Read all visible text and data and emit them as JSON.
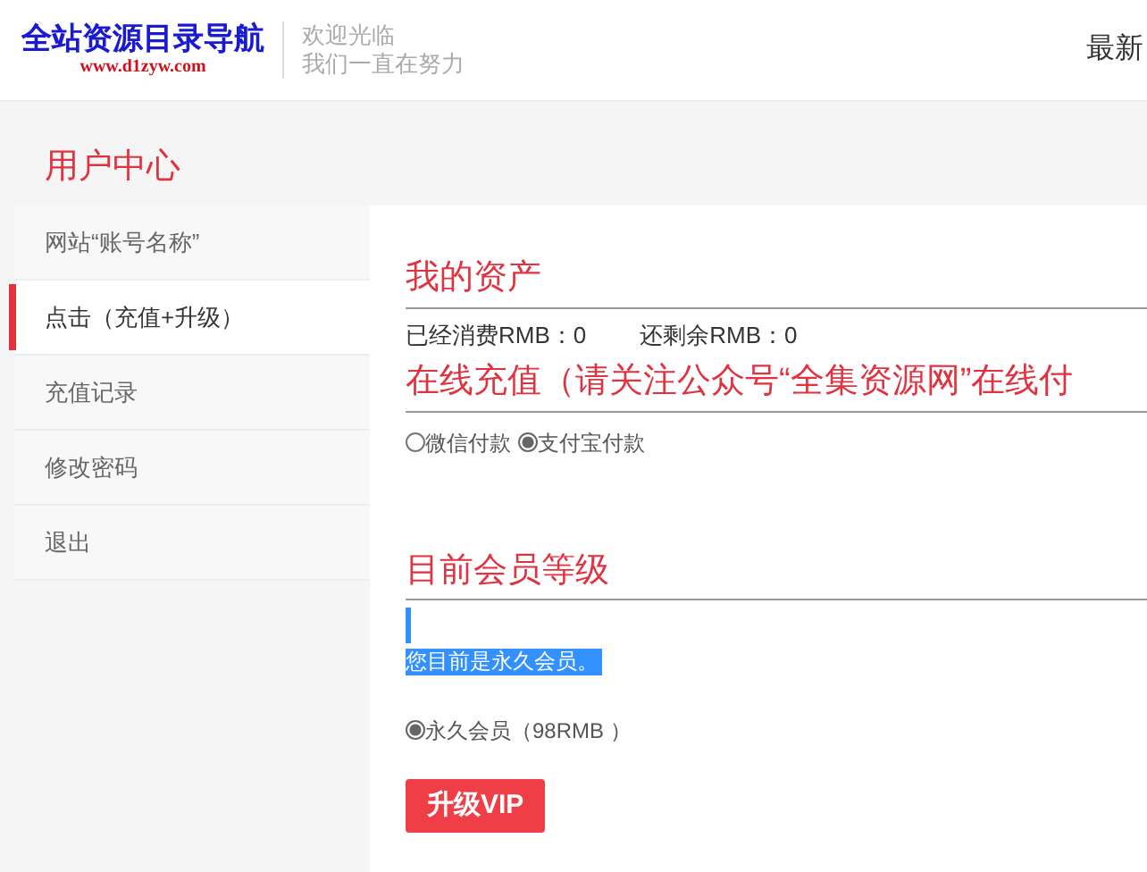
{
  "header": {
    "logo_title": "全站资源目录导航",
    "logo_url": "www.d1zyw.com",
    "tagline": [
      "欢迎光临",
      "我们一直在努力"
    ],
    "nav_item": "最新"
  },
  "sidebar": {
    "title": "用户中心",
    "items": [
      {
        "label": "网站“账号名称”",
        "selected": false
      },
      {
        "label": "点击（充值+升级）",
        "selected": true
      },
      {
        "label": "充值记录",
        "selected": false
      },
      {
        "label": "修改密码",
        "selected": false
      },
      {
        "label": "退出",
        "selected": false
      }
    ]
  },
  "assets": {
    "title": "我的资产",
    "stats": [
      "已经消费RMB：0",
      "还剩余RMB：0"
    ]
  },
  "recharge": {
    "title": "在线充值（请关注公众号“全集资源网”在线付",
    "payment_options": [
      {
        "label": "微信付款",
        "selected": false
      },
      {
        "label": "支付宝付款",
        "selected": true
      }
    ]
  },
  "membership": {
    "title": "目前会员等级",
    "status": {
      "text": "您目前是永久会员。",
      "highlighted": true
    },
    "plans": [
      {
        "label": "永久会员（98RMB ）",
        "selected": true
      }
    ],
    "button": "升级VIP"
  }
}
